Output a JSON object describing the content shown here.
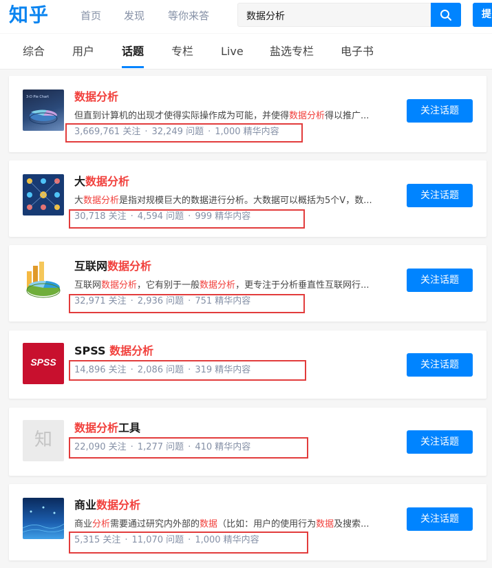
{
  "header": {
    "logo": "知乎",
    "nav": [
      "首页",
      "发现",
      "等你来答"
    ],
    "search_value": "数据分析",
    "ask_label": "提"
  },
  "tabs": [
    "综合",
    "用户",
    "话题",
    "专栏",
    "Live",
    "盐选专栏",
    "电子书"
  ],
  "active_tab": "话题",
  "colors": {
    "brand": "#0084ff",
    "highlight": "#f1403c",
    "annotation_box": "#e23b3b"
  },
  "follow_label": "关注话题",
  "meta_labels": {
    "followers": "关注",
    "questions": "问题",
    "featured": "精华内容",
    "separator": "·"
  },
  "results": [
    {
      "title_pre": "",
      "title_hl": "数据分析",
      "title_post": "",
      "excerpt": [
        [
          "但直到计算机的出现才使得实际操作成为可能，并使得",
          false
        ],
        [
          "数据分析",
          true
        ],
        [
          "得以推广...",
          false
        ]
      ],
      "followers": "3,669,761",
      "questions": "32,249",
      "featured": "1,000",
      "thumb_icon": "3d-pie-chart-thumbnail",
      "thumb_caption": "3-D Pie Chart"
    },
    {
      "title_pre": "大",
      "title_hl": "数据分析",
      "title_post": "",
      "excerpt": [
        [
          "大",
          false
        ],
        [
          "数据分析",
          true
        ],
        [
          "是指对规模巨大的数据进行分析。大数据可以概括为5个V，数...",
          false
        ]
      ],
      "followers": "30,718",
      "questions": "4,594",
      "featured": "999",
      "thumb_icon": "people-network-thumbnail"
    },
    {
      "title_pre": "互联网",
      "title_hl": "数据分析",
      "title_post": "",
      "excerpt": [
        [
          "互联网",
          false
        ],
        [
          "数据分析",
          true
        ],
        [
          "，它有别于一般",
          false
        ],
        [
          "数据分析",
          true
        ],
        [
          "，更专注于分析垂直性互联网行...",
          false
        ]
      ],
      "followers": "32,971",
      "questions": "2,936",
      "featured": "751",
      "thumb_icon": "pie-bar-chart-thumbnail"
    },
    {
      "title_pre": "SPSS ",
      "title_hl": "数据分析",
      "title_post": "",
      "excerpt": [],
      "followers": "14,896",
      "questions": "2,086",
      "featured": "319",
      "thumb_icon": "spss-logo",
      "thumb_caption": "SPSS"
    },
    {
      "title_pre": "",
      "title_hl": "数据分析",
      "title_post": "工具",
      "excerpt": [],
      "followers": "22,090",
      "questions": "1,277",
      "featured": "410",
      "thumb_icon": "zhihu-placeholder-icon",
      "thumb_caption": "知"
    },
    {
      "title_pre": "商业",
      "title_hl": "数据分析",
      "title_post": "",
      "excerpt": [
        [
          "商业",
          false
        ],
        [
          "分析",
          true
        ],
        [
          "需要通过研究内外部的",
          false
        ],
        [
          "数据",
          true
        ],
        [
          "（比如：用户的使用行为",
          false
        ],
        [
          "数据",
          true
        ],
        [
          "及搜索...",
          false
        ]
      ],
      "followers": "5,315",
      "questions": "11,070",
      "featured": "1,000",
      "thumb_icon": "business-analytics-thumbnail"
    }
  ]
}
